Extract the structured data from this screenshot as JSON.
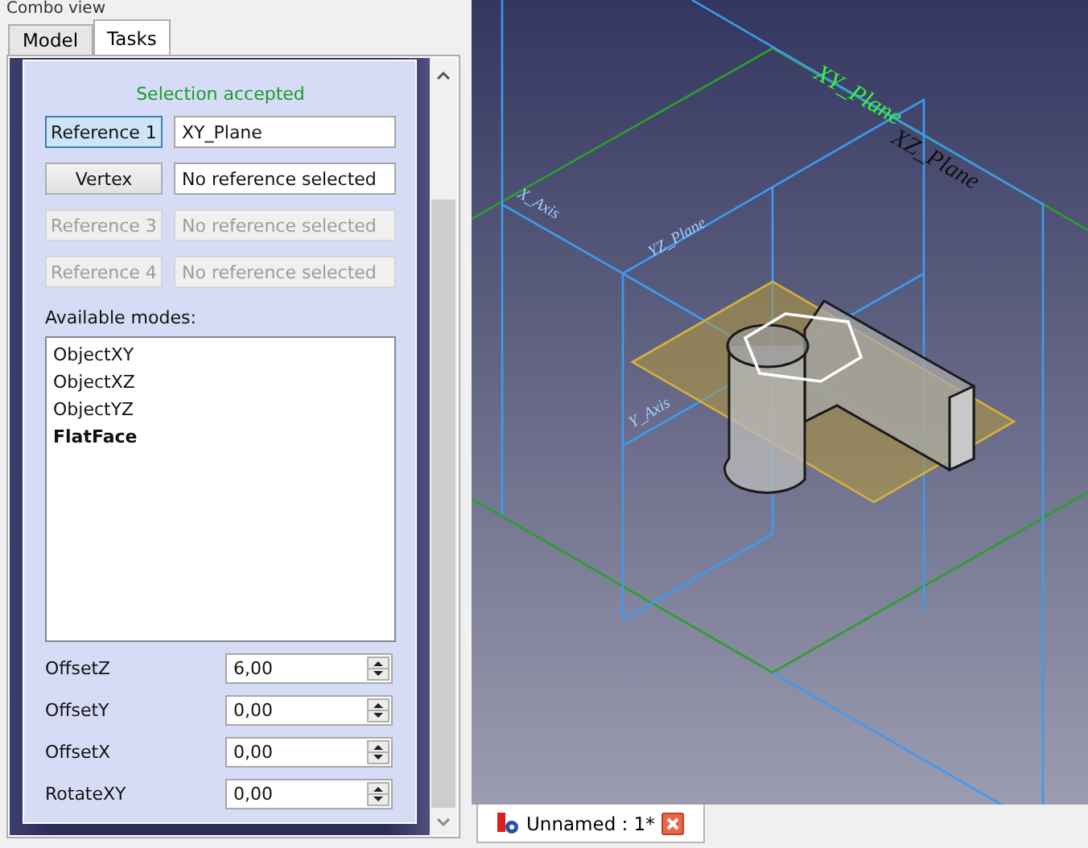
{
  "panel": {
    "title": "Combo view"
  },
  "tabs": [
    {
      "label": "Model",
      "selected": false
    },
    {
      "label": "Tasks",
      "selected": true
    }
  ],
  "status": "Selection accepted",
  "references": [
    {
      "button": "Reference 1",
      "value": "XY_Plane",
      "active": true,
      "disabled": false
    },
    {
      "button": "Vertex",
      "value": "No reference selected",
      "active": false,
      "disabled": false
    },
    {
      "button": "Reference 3",
      "value": "No reference selected",
      "active": false,
      "disabled": true
    },
    {
      "button": "Reference 4",
      "value": "No reference selected",
      "active": false,
      "disabled": true
    }
  ],
  "modes_label": "Available modes:",
  "modes": [
    {
      "label": "ObjectXY",
      "current": false
    },
    {
      "label": "ObjectXZ",
      "current": false
    },
    {
      "label": "ObjectYZ",
      "current": false
    },
    {
      "label": "FlatFace",
      "current": true
    }
  ],
  "offsets": [
    {
      "label": "OffsetZ",
      "value": "6,00"
    },
    {
      "label": "OffsetY",
      "value": "0,00"
    },
    {
      "label": "OffsetX",
      "value": "0,00"
    },
    {
      "label": "RotateXY",
      "value": "0,00"
    }
  ],
  "viewport": {
    "labels": [
      {
        "text": "XY_Plane",
        "kind": "highlight"
      },
      {
        "text": "XZ_Plane",
        "kind": "mirrored"
      },
      {
        "text": "X_Axis",
        "kind": "faint"
      },
      {
        "text": "YZ_Plane",
        "kind": "faint"
      },
      {
        "text": "Y_Axis",
        "kind": "faint"
      }
    ]
  },
  "document_tabs": [
    {
      "label": "Unnamed : 1*",
      "selected": true
    }
  ]
}
